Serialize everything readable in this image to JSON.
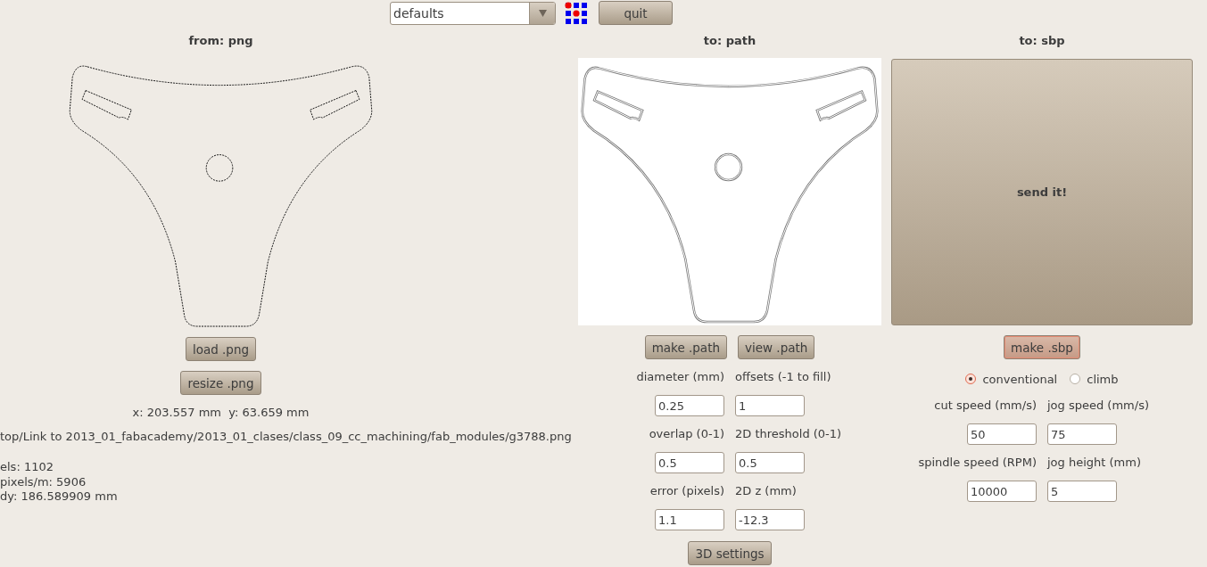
{
  "top_bar": {
    "preset_select": {
      "value": "defaults"
    },
    "quit_button": "quit"
  },
  "from_panel": {
    "title": "from: png",
    "buttons": [
      "load .png",
      "resize .png"
    ],
    "size_readout": "x: 203.557 mm  y: 63.659 mm",
    "file_path": "top/Link to 2013_01_fabacademy/2013_01_clases/class_09_cc_machining/fab_modules/g3788.png",
    "info_lines": [
      "els: 1102",
      "pixels/m: 5906",
      "dy: 186.589909 mm"
    ]
  },
  "path_panel": {
    "title": "to: path",
    "buttons": [
      "make .path",
      "view .path"
    ],
    "fields": [
      {
        "label": "diameter (mm)",
        "value": "0.25"
      },
      {
        "label": "offsets (-1 to fill)",
        "value": "1"
      },
      {
        "label": "overlap (0-1)",
        "value": "0.5"
      },
      {
        "label": "2D threshold (0-1)",
        "value": "0.5"
      },
      {
        "label": "error (pixels)",
        "value": "1.1"
      },
      {
        "label": "2D z (mm)",
        "value": "-12.3"
      }
    ],
    "settings_button": "3D settings"
  },
  "sbp_panel": {
    "title": "to: sbp",
    "send_button": "send it!",
    "make_button": {
      "label": "make .sbp",
      "highlighted": true
    },
    "direction": [
      {
        "label": "conventional",
        "selected": true
      },
      {
        "label": "climb",
        "selected": false
      }
    ],
    "fields": [
      {
        "label": "cut speed (mm/s)",
        "value": "50"
      },
      {
        "label": "jog speed (mm/s)",
        "value": "75"
      },
      {
        "label": "spindle speed (RPM)",
        "value": "10000"
      },
      {
        "label": "jog height (mm)",
        "value": "5"
      }
    ]
  }
}
